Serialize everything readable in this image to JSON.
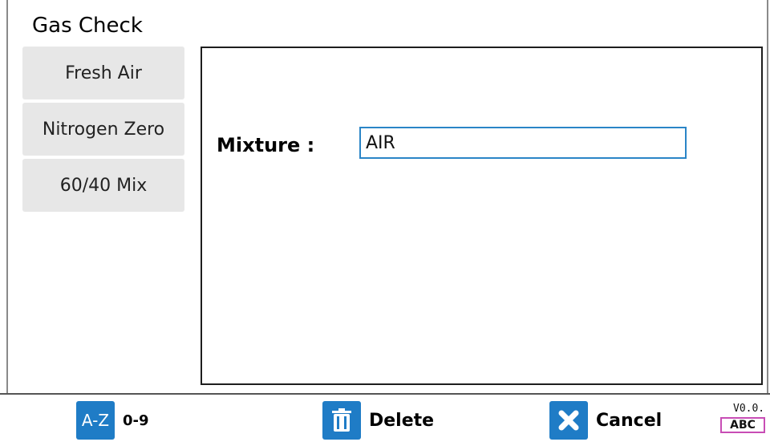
{
  "app": {
    "title": "Gas Check"
  },
  "presets": [
    {
      "label": "Fresh Air"
    },
    {
      "label": "Nitrogen Zero"
    },
    {
      "label": "60/40 Mix"
    }
  ],
  "form": {
    "mixture_label": "Mixture :",
    "mixture_value": "AIR"
  },
  "toolbar": {
    "az_label": "A-Z",
    "numeric_label": "0-9",
    "delete_label": "Delete",
    "cancel_label": "Cancel",
    "version": "V0.0.",
    "input_mode": "ABC"
  },
  "icons": {
    "delete": "trash-icon",
    "cancel": "close-icon"
  },
  "colors": {
    "accent": "#1f7cc6",
    "input_focus_border": "#2a85c7",
    "preset_bg": "#e7e7e7",
    "mode_badge_border": "#c84db5"
  }
}
